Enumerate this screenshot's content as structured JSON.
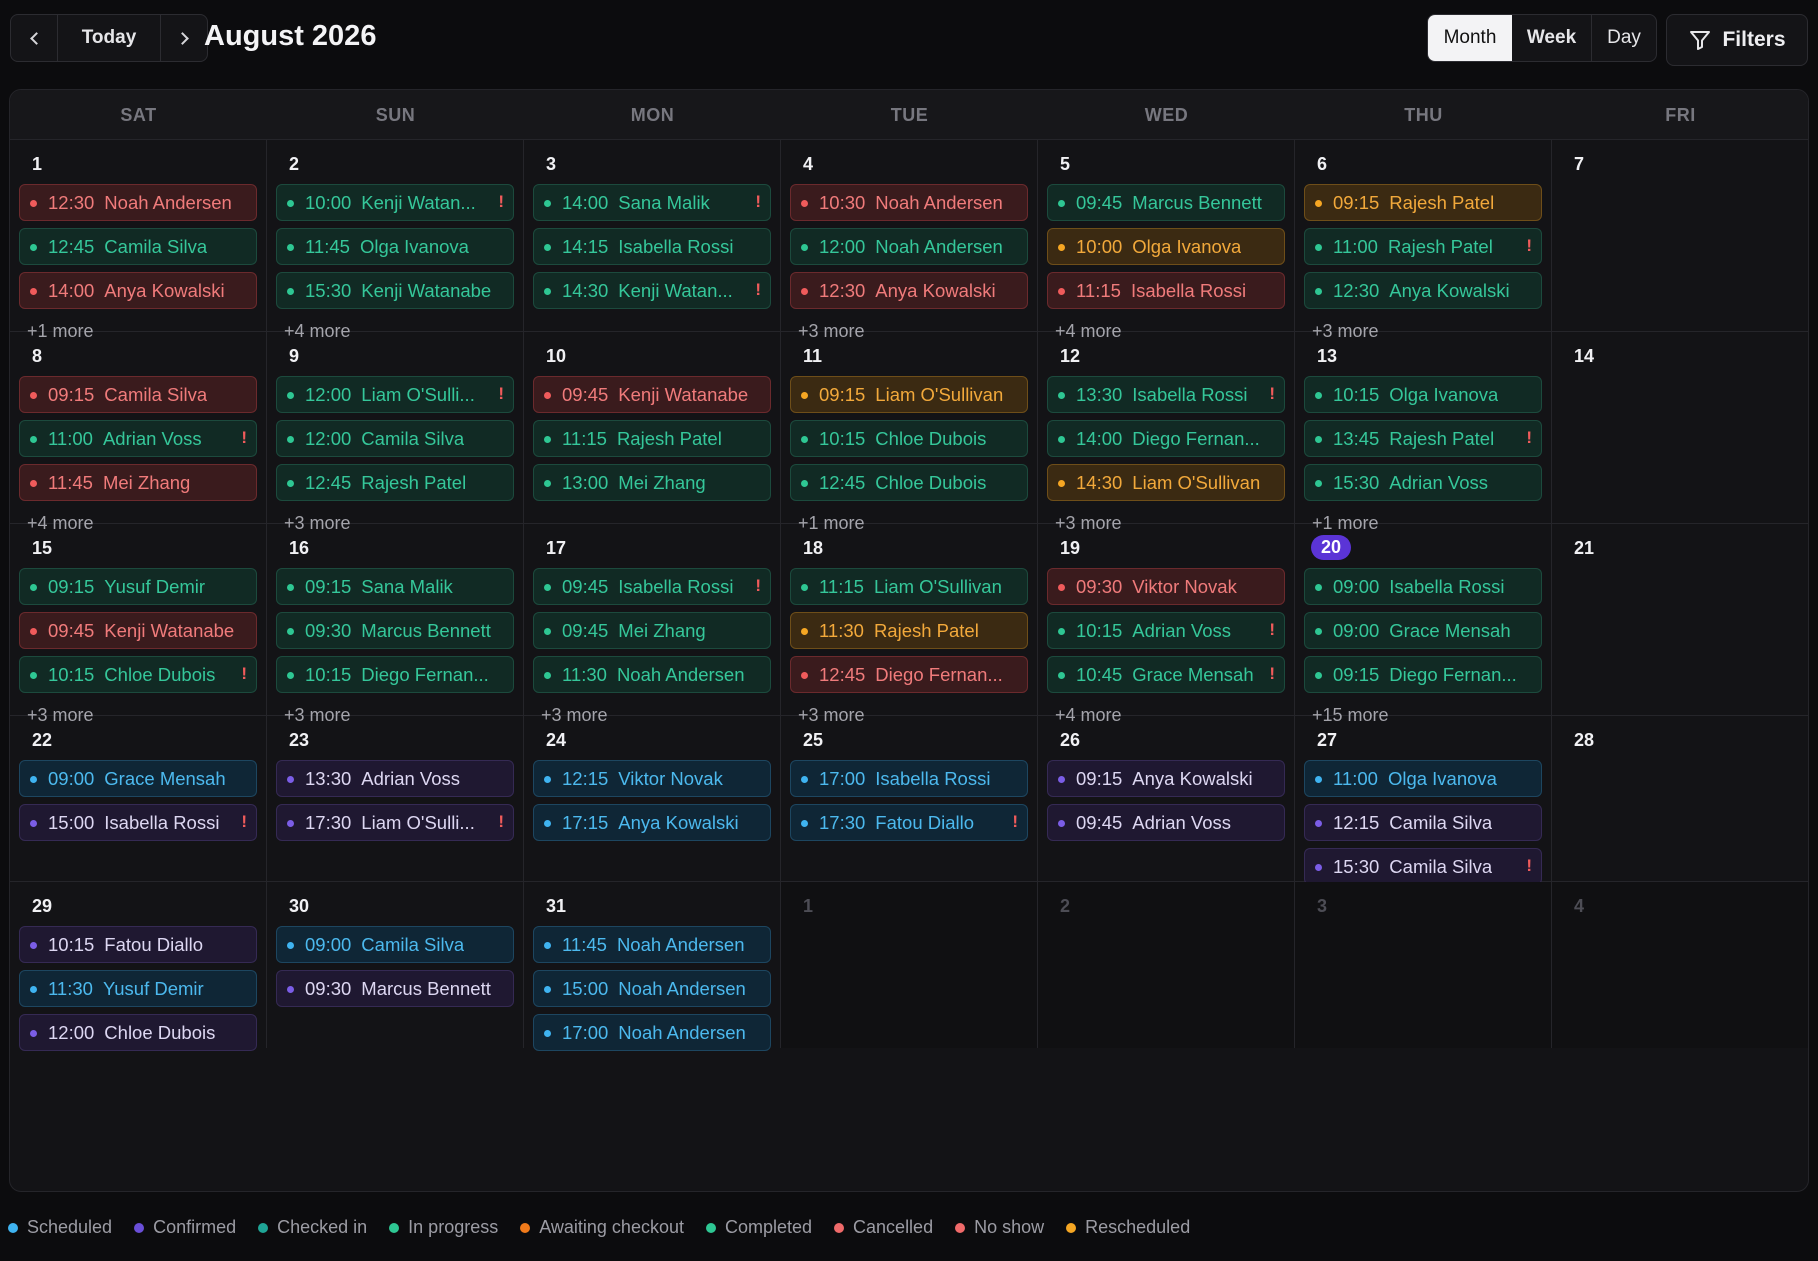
{
  "toolbar": {
    "today_label": "Today",
    "title": "August 2026",
    "views": [
      "Month",
      "Week",
      "Day"
    ],
    "filters_label": "Filters",
    "icons": [
      "chevron-left-icon",
      "chevron-right-icon",
      "filter-icon"
    ]
  },
  "weekdays": [
    "SAT",
    "SUN",
    "MON",
    "TUE",
    "WED",
    "THU",
    "FRI"
  ],
  "colors": {
    "scheduled": "#3fb3f0",
    "confirmed": "#7b5de6",
    "checked_in": "#1fa596",
    "in_progress": "#2ec793",
    "awaiting_checkout": "#f07a1a",
    "completed": "#2ec793",
    "cancelled": "#ef5b5b",
    "no_show": "#f06a6a",
    "rescheduled": "#f5a623",
    "today_badge": "#5b34d6"
  },
  "today": "20",
  "weeks": [
    {
      "days": [
        {
          "num": "1",
          "events": [
            {
              "time": "12:30",
              "name": "Noah Andersen",
              "status": "red"
            },
            {
              "time": "12:45",
              "name": "Camila Silva",
              "status": "green"
            },
            {
              "time": "14:00",
              "name": "Anya Kowalski",
              "status": "red"
            }
          ],
          "more": "+1 more"
        },
        {
          "num": "2",
          "events": [
            {
              "time": "10:00",
              "name": "Kenji Watan...",
              "status": "green",
              "flag": "!"
            },
            {
              "time": "11:45",
              "name": "Olga Ivanova",
              "status": "green"
            },
            {
              "time": "15:30",
              "name": "Kenji Watanabe",
              "status": "green"
            }
          ],
          "more": "+4 more"
        },
        {
          "num": "3",
          "events": [
            {
              "time": "14:00",
              "name": "Sana Malik",
              "status": "green",
              "flag": "!"
            },
            {
              "time": "14:15",
              "name": "Isabella Rossi",
              "status": "green"
            },
            {
              "time": "14:30",
              "name": "Kenji Watan...",
              "status": "green",
              "flag": "!"
            }
          ]
        },
        {
          "num": "4",
          "events": [
            {
              "time": "10:30",
              "name": "Noah Andersen",
              "status": "red"
            },
            {
              "time": "12:00",
              "name": "Noah Andersen",
              "status": "green"
            },
            {
              "time": "12:30",
              "name": "Anya Kowalski",
              "status": "red"
            }
          ],
          "more": "+3 more"
        },
        {
          "num": "5",
          "events": [
            {
              "time": "09:45",
              "name": "Marcus Bennett",
              "status": "green"
            },
            {
              "time": "10:00",
              "name": "Olga Ivanova",
              "status": "amber"
            },
            {
              "time": "11:15",
              "name": "Isabella Rossi",
              "status": "red"
            }
          ],
          "more": "+4 more"
        },
        {
          "num": "6",
          "events": [
            {
              "time": "09:15",
              "name": "Rajesh Patel",
              "status": "amber"
            },
            {
              "time": "11:00",
              "name": "Rajesh Patel",
              "status": "green",
              "flag": "!"
            },
            {
              "time": "12:30",
              "name": "Anya Kowalski",
              "status": "green"
            }
          ],
          "more": "+3 more"
        },
        {
          "num": "7",
          "events": []
        }
      ]
    },
    {
      "days": [
        {
          "num": "8",
          "events": [
            {
              "time": "09:15",
              "name": "Camila Silva",
              "status": "red"
            },
            {
              "time": "11:00",
              "name": "Adrian Voss",
              "status": "green",
              "flag": "!"
            },
            {
              "time": "11:45",
              "name": "Mei Zhang",
              "status": "red"
            }
          ],
          "more": "+4 more"
        },
        {
          "num": "9",
          "events": [
            {
              "time": "12:00",
              "name": "Liam O'Sulli...",
              "status": "green",
              "flag": "!"
            },
            {
              "time": "12:00",
              "name": "Camila Silva",
              "status": "green"
            },
            {
              "time": "12:45",
              "name": "Rajesh Patel",
              "status": "green"
            }
          ],
          "more": "+3 more"
        },
        {
          "num": "10",
          "events": [
            {
              "time": "09:45",
              "name": "Kenji Watanabe",
              "status": "red"
            },
            {
              "time": "11:15",
              "name": "Rajesh Patel",
              "status": "green"
            },
            {
              "time": "13:00",
              "name": "Mei Zhang",
              "status": "green"
            }
          ]
        },
        {
          "num": "11",
          "events": [
            {
              "time": "09:15",
              "name": "Liam O'Sullivan",
              "status": "amber"
            },
            {
              "time": "10:15",
              "name": "Chloe Dubois",
              "status": "green"
            },
            {
              "time": "12:45",
              "name": "Chloe Dubois",
              "status": "green"
            }
          ],
          "more": "+1 more"
        },
        {
          "num": "12",
          "events": [
            {
              "time": "13:30",
              "name": "Isabella Rossi",
              "status": "green",
              "flag": "!"
            },
            {
              "time": "14:00",
              "name": "Diego Fernan...",
              "status": "green"
            },
            {
              "time": "14:30",
              "name": "Liam O'Sullivan",
              "status": "amber"
            }
          ],
          "more": "+3 more"
        },
        {
          "num": "13",
          "events": [
            {
              "time": "10:15",
              "name": "Olga Ivanova",
              "status": "green"
            },
            {
              "time": "13:45",
              "name": "Rajesh Patel",
              "status": "green",
              "flag": "!"
            },
            {
              "time": "15:30",
              "name": "Adrian Voss",
              "status": "green"
            }
          ],
          "more": "+1 more"
        },
        {
          "num": "14",
          "events": []
        }
      ]
    },
    {
      "days": [
        {
          "num": "15",
          "events": [
            {
              "time": "09:15",
              "name": "Yusuf Demir",
              "status": "green"
            },
            {
              "time": "09:45",
              "name": "Kenji Watanabe",
              "status": "red"
            },
            {
              "time": "10:15",
              "name": "Chloe Dubois",
              "status": "green",
              "flag": "!"
            }
          ],
          "more": "+3 more"
        },
        {
          "num": "16",
          "events": [
            {
              "time": "09:15",
              "name": "Sana Malik",
              "status": "green"
            },
            {
              "time": "09:30",
              "name": "Marcus Bennett",
              "status": "green"
            },
            {
              "time": "10:15",
              "name": "Diego Fernan...",
              "status": "green"
            }
          ],
          "more": "+3 more"
        },
        {
          "num": "17",
          "events": [
            {
              "time": "09:45",
              "name": "Isabella Rossi",
              "status": "green",
              "flag": "!"
            },
            {
              "time": "09:45",
              "name": "Mei Zhang",
              "status": "green"
            },
            {
              "time": "11:30",
              "name": "Noah Andersen",
              "status": "green"
            }
          ],
          "more": "+3 more"
        },
        {
          "num": "18",
          "events": [
            {
              "time": "11:15",
              "name": "Liam O'Sullivan",
              "status": "green"
            },
            {
              "time": "11:30",
              "name": "Rajesh Patel",
              "status": "amber"
            },
            {
              "time": "12:45",
              "name": "Diego Fernan...",
              "status": "red"
            }
          ],
          "more": "+3 more"
        },
        {
          "num": "19",
          "events": [
            {
              "time": "09:30",
              "name": "Viktor Novak",
              "status": "red"
            },
            {
              "time": "10:15",
              "name": "Adrian Voss",
              "status": "green",
              "flag": "!"
            },
            {
              "time": "10:45",
              "name": "Grace Mensah",
              "status": "green",
              "flag": "!"
            }
          ],
          "more": "+4 more"
        },
        {
          "num": "20",
          "today": true,
          "events": [
            {
              "time": "09:00",
              "name": "Isabella Rossi",
              "status": "green"
            },
            {
              "time": "09:00",
              "name": "Grace Mensah",
              "status": "green"
            },
            {
              "time": "09:15",
              "name": "Diego Fernan...",
              "status": "green"
            }
          ],
          "more": "+15 more"
        },
        {
          "num": "21",
          "events": []
        }
      ]
    },
    {
      "days": [
        {
          "num": "22",
          "events": [
            {
              "time": "09:00",
              "name": "Grace Mensah",
              "status": "blue"
            },
            {
              "time": "15:00",
              "name": "Isabella Rossi",
              "status": "purple",
              "flag": "!"
            }
          ]
        },
        {
          "num": "23",
          "events": [
            {
              "time": "13:30",
              "name": "Adrian Voss",
              "status": "purple"
            },
            {
              "time": "17:30",
              "name": "Liam O'Sulli...",
              "status": "purple",
              "flag": "!"
            }
          ]
        },
        {
          "num": "24",
          "events": [
            {
              "time": "12:15",
              "name": "Viktor Novak",
              "status": "blue"
            },
            {
              "time": "17:15",
              "name": "Anya Kowalski",
              "status": "blue"
            }
          ]
        },
        {
          "num": "25",
          "events": [
            {
              "time": "17:00",
              "name": "Isabella Rossi",
              "status": "blue"
            },
            {
              "time": "17:30",
              "name": "Fatou Diallo",
              "status": "blue",
              "flag": "!"
            }
          ]
        },
        {
          "num": "26",
          "events": [
            {
              "time": "09:15",
              "name": "Anya Kowalski",
              "status": "purple"
            },
            {
              "time": "09:45",
              "name": "Adrian Voss",
              "status": "purple"
            }
          ]
        },
        {
          "num": "27",
          "events": [
            {
              "time": "11:00",
              "name": "Olga Ivanova",
              "status": "blue"
            },
            {
              "time": "12:15",
              "name": "Camila Silva",
              "status": "purple"
            },
            {
              "time": "15:30",
              "name": "Camila Silva",
              "status": "purple",
              "flag": "!"
            }
          ]
        },
        {
          "num": "28",
          "events": []
        }
      ]
    },
    {
      "days": [
        {
          "num": "29",
          "events": [
            {
              "time": "10:15",
              "name": "Fatou Diallo",
              "status": "purple"
            },
            {
              "time": "11:30",
              "name": "Yusuf Demir",
              "status": "blue"
            },
            {
              "time": "12:00",
              "name": "Chloe Dubois",
              "status": "purple"
            }
          ]
        },
        {
          "num": "30",
          "events": [
            {
              "time": "09:00",
              "name": "Camila Silva",
              "status": "blue"
            },
            {
              "time": "09:30",
              "name": "Marcus Bennett",
              "status": "purple"
            }
          ]
        },
        {
          "num": "31",
          "events": [
            {
              "time": "11:45",
              "name": "Noah Andersen",
              "status": "blue"
            },
            {
              "time": "15:00",
              "name": "Noah Andersen",
              "status": "blue"
            },
            {
              "time": "17:00",
              "name": "Noah Andersen",
              "status": "blue"
            }
          ]
        },
        {
          "num": "1",
          "outside": true,
          "events": []
        },
        {
          "num": "2",
          "outside": true,
          "events": []
        },
        {
          "num": "3",
          "outside": true,
          "events": []
        },
        {
          "num": "4",
          "outside": true,
          "events": []
        }
      ]
    }
  ],
  "legend": [
    {
      "label": "Scheduled",
      "color": "#3fb3f0"
    },
    {
      "label": "Confirmed",
      "color": "#6a4fd8"
    },
    {
      "label": "Checked in",
      "color": "#1fa596"
    },
    {
      "label": "In progress",
      "color": "#2ec793"
    },
    {
      "label": "Awaiting checkout",
      "color": "#f07a1a"
    },
    {
      "label": "Completed",
      "color": "#2ec793"
    },
    {
      "label": "Cancelled",
      "color": "#ef6a6a"
    },
    {
      "label": "No show",
      "color": "#f06a6a"
    },
    {
      "label": "Rescheduled",
      "color": "#f5a623"
    }
  ]
}
